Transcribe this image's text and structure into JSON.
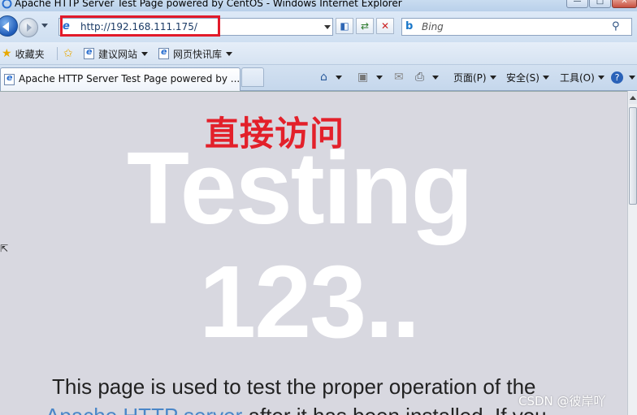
{
  "window": {
    "title": "Apache HTTP Server Test Page powered by CentOS - Windows Internet Explorer",
    "minimize_glyph": "—",
    "maximize_glyph": "□",
    "close_glyph": "✕"
  },
  "nav": {
    "address": "http://192.168.111.175/",
    "search_placeholder": "Bing",
    "highlight_color": "#e21a2a"
  },
  "favorites": {
    "label": "收藏夹",
    "items": [
      {
        "label": "建议网站"
      },
      {
        "label": "网页快讯库"
      }
    ]
  },
  "tab": {
    "title": "Apache HTTP Server Test Page powered by ..."
  },
  "commands": {
    "page": "页面(P)",
    "safety": "安全(S)",
    "tools": "工具(O)"
  },
  "content": {
    "annotation": "直接访问",
    "annotation_color": "#e3202a",
    "headline_1": "Testing",
    "headline_2": "123..",
    "body_line_1": "This page is used to test the proper operation of the",
    "link_text": "Apache HTTP server",
    "body_line_2_rest": " after it has been installed. If you"
  },
  "watermark": "CSDN @彼岸吖"
}
